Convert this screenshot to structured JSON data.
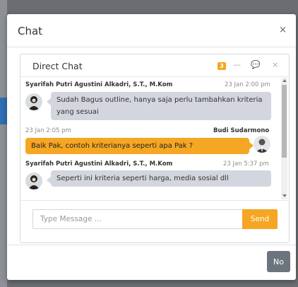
{
  "modal": {
    "title": "Chat",
    "close_glyph": "×"
  },
  "card": {
    "title": "Direct Chat",
    "badge_count": "3",
    "tools": {
      "minus_glyph": "—",
      "chat_glyph": "💬",
      "close_glyph": "×"
    }
  },
  "messages": [
    {
      "name": "Syarifah Putri Agustini Alkadri, S.T., M.Kom",
      "time": "23 Jan 2:00 pm",
      "text": "Sudah Bagus outline, hanya saja perlu tambahkan kriteria yang sesuai",
      "side": "left"
    },
    {
      "name": "Budi Sudarmono",
      "time": "23 Jan 2:05 pm",
      "text": "Baik Pak, contoh kriterianya seperti apa Pak ?",
      "side": "right"
    },
    {
      "name": "Syarifah Putri Agustini Alkadri, S.T., M.Kom",
      "time": "23 Jan 5:37 pm",
      "text": "Seperti ini kriteria seperti harga, media sosial dll",
      "side": "left"
    }
  ],
  "footer": {
    "input_placeholder": "Type Message ...",
    "send_label": "Send"
  },
  "modal_footer": {
    "no_label": "No"
  },
  "colors": {
    "accent": "#f5a623",
    "bubble_left": "#d3d6de",
    "button_secondary": "#6c757d"
  }
}
